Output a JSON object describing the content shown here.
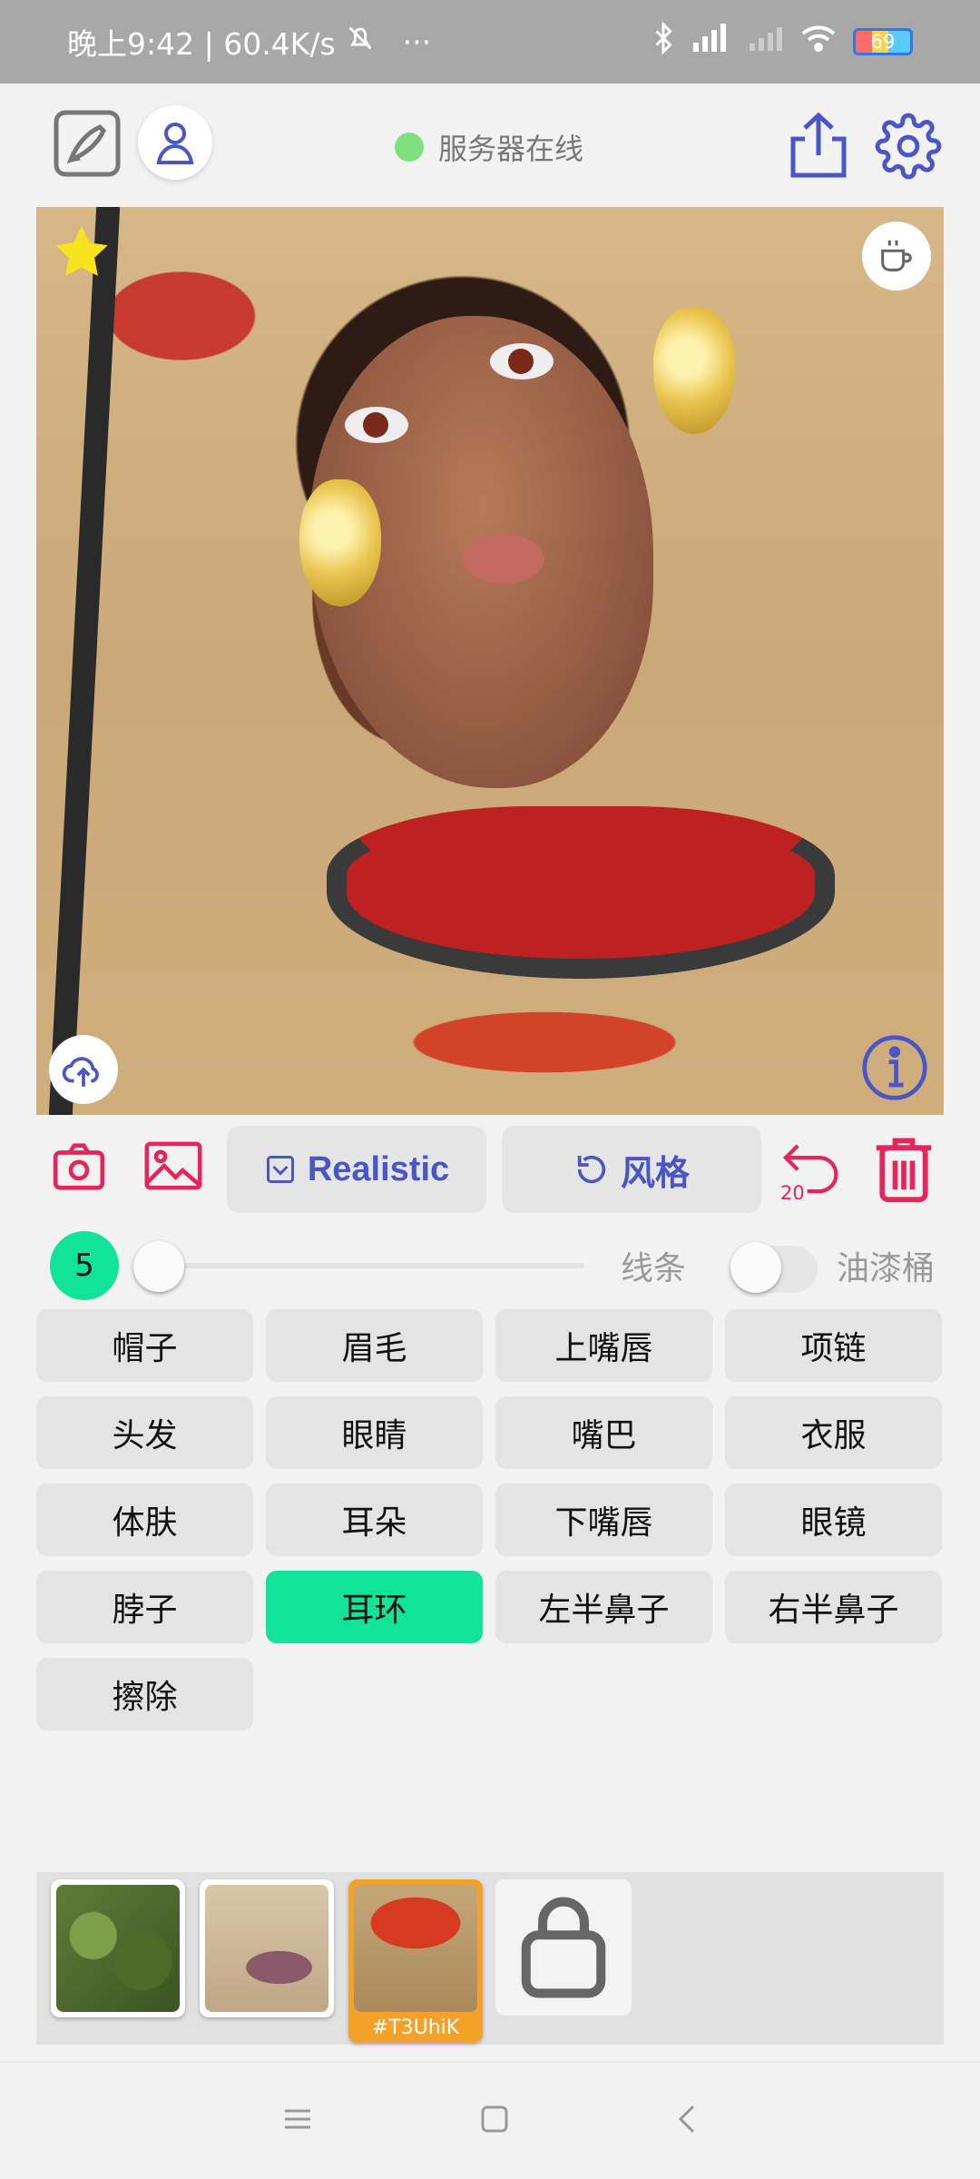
{
  "status_bar": {
    "time_speed": "晚上9:42 | 60.4K/s",
    "more": "···",
    "battery": "69"
  },
  "header": {
    "server_status": "服务器在线",
    "status_color": "#7ee07e"
  },
  "canvas": {
    "favorite_icon": "star-icon",
    "coffee_icon": "coffee-icon",
    "upload_icon": "cloud-upload-icon",
    "info_icon": "info-icon"
  },
  "toolbar": {
    "style_model_label": "Realistic",
    "style_button_label": "风格",
    "undo_count": "20"
  },
  "brush": {
    "size": "5",
    "line_label": "线条",
    "bucket_label": "油漆桶"
  },
  "parts": [
    {
      "label": "帽子",
      "active": false
    },
    {
      "label": "眉毛",
      "active": false
    },
    {
      "label": "上嘴唇",
      "active": false
    },
    {
      "label": "项链",
      "active": false
    },
    {
      "label": "头发",
      "active": false
    },
    {
      "label": "眼睛",
      "active": false
    },
    {
      "label": "嘴巴",
      "active": false
    },
    {
      "label": "衣服",
      "active": false
    },
    {
      "label": "体肤",
      "active": false
    },
    {
      "label": "耳朵",
      "active": false
    },
    {
      "label": "下嘴唇",
      "active": false
    },
    {
      "label": "眼镜",
      "active": false
    },
    {
      "label": "脖子",
      "active": false
    },
    {
      "label": "耳环",
      "active": true
    },
    {
      "label": "左半鼻子",
      "active": false
    },
    {
      "label": "右半鼻子",
      "active": false
    },
    {
      "label": "擦除",
      "active": false
    }
  ],
  "palette": {
    "selected_tag": "#T3UhiK"
  },
  "colors": {
    "accent_green": "#11e39a",
    "accent_red": "#e8245a",
    "accent_blue": "#4a55c8"
  }
}
